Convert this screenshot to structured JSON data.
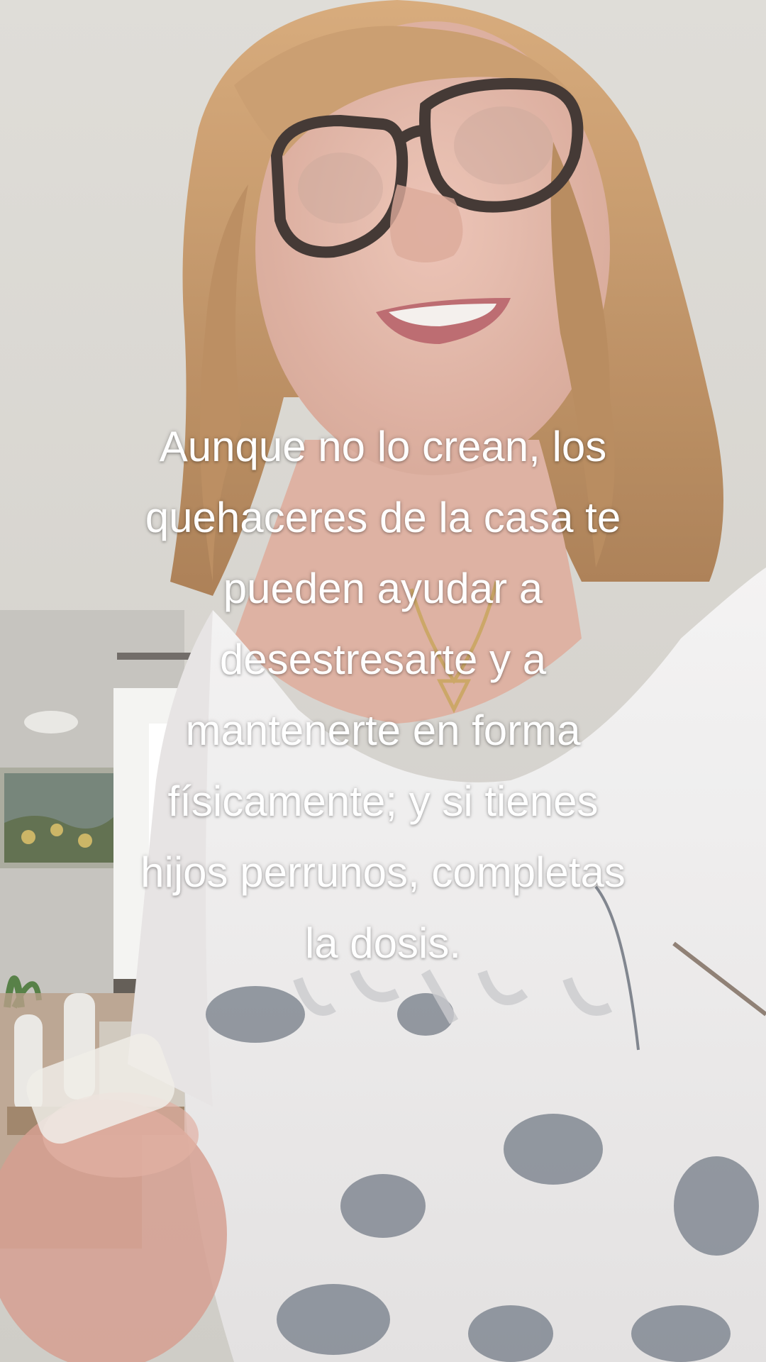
{
  "caption": {
    "lines": [
      "Aunque no lo crean, los",
      "quehaceres de la casa te",
      "pueden ayudar a",
      "desestresarte y a",
      "mantenerte en forma",
      "físicamente; y si tienes",
      "hijos perrunos, completas",
      "la dosis."
    ]
  },
  "colors": {
    "caption_text": "#ffffff",
    "ceiling": "#d8d6d1",
    "wall": "#c9c6c0",
    "hair": "#c49563",
    "skin": "#e2b4a6",
    "shirt": "#eeecec",
    "shirt_print": "#6c7480",
    "glasses": "#3a2e2a"
  }
}
